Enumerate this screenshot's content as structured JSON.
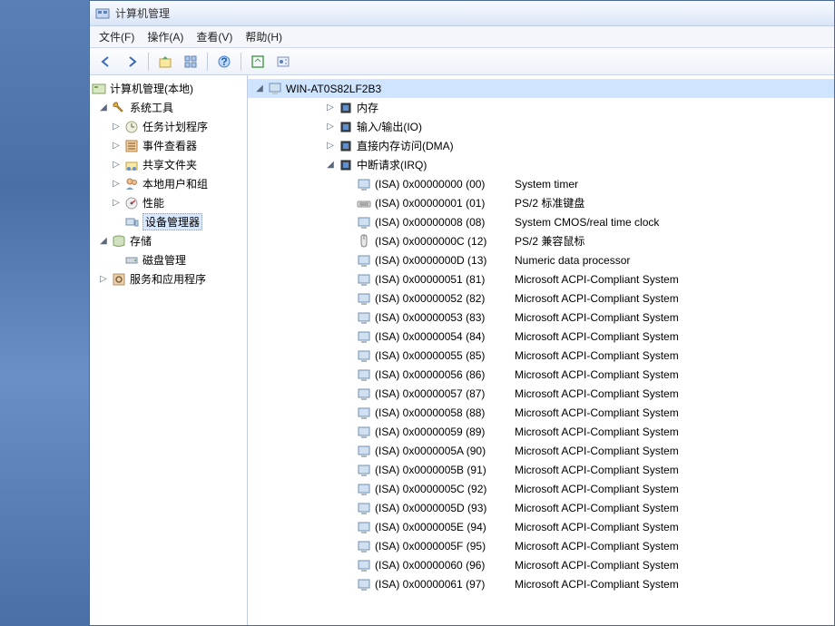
{
  "title": "计算机管理",
  "menu": {
    "file": "文件(F)",
    "action": "操作(A)",
    "view": "查看(V)",
    "help": "帮助(H)"
  },
  "left": {
    "root": "计算机管理(本地)",
    "system_tools": "系统工具",
    "task_scheduler": "任务计划程序",
    "event_viewer": "事件查看器",
    "shared_folders": "共享文件夹",
    "local_users": "本地用户和组",
    "performance": "性能",
    "device_manager": "设备管理器",
    "storage": "存储",
    "disk_mgmt": "磁盘管理",
    "services_apps": "服务和应用程序"
  },
  "right": {
    "computer": "WIN-AT0S82LF2B3",
    "memory": "内存",
    "io": "输入/输出(IO)",
    "dma": "直接内存访问(DMA)",
    "irq": "中断请求(IRQ)",
    "items": [
      {
        "addr": "(ISA) 0x00000000 (00)",
        "desc": "System timer"
      },
      {
        "addr": "(ISA) 0x00000001 (01)",
        "desc": "PS/2 标准键盘"
      },
      {
        "addr": "(ISA) 0x00000008 (08)",
        "desc": "System CMOS/real time clock"
      },
      {
        "addr": "(ISA) 0x0000000C (12)",
        "desc": "PS/2 兼容鼠标"
      },
      {
        "addr": "(ISA) 0x0000000D (13)",
        "desc": "Numeric data processor"
      },
      {
        "addr": "(ISA) 0x00000051 (81)",
        "desc": "Microsoft ACPI-Compliant System"
      },
      {
        "addr": "(ISA) 0x00000052 (82)",
        "desc": "Microsoft ACPI-Compliant System"
      },
      {
        "addr": "(ISA) 0x00000053 (83)",
        "desc": "Microsoft ACPI-Compliant System"
      },
      {
        "addr": "(ISA) 0x00000054 (84)",
        "desc": "Microsoft ACPI-Compliant System"
      },
      {
        "addr": "(ISA) 0x00000055 (85)",
        "desc": "Microsoft ACPI-Compliant System"
      },
      {
        "addr": "(ISA) 0x00000056 (86)",
        "desc": "Microsoft ACPI-Compliant System"
      },
      {
        "addr": "(ISA) 0x00000057 (87)",
        "desc": "Microsoft ACPI-Compliant System"
      },
      {
        "addr": "(ISA) 0x00000058 (88)",
        "desc": "Microsoft ACPI-Compliant System"
      },
      {
        "addr": "(ISA) 0x00000059 (89)",
        "desc": "Microsoft ACPI-Compliant System"
      },
      {
        "addr": "(ISA) 0x0000005A (90)",
        "desc": "Microsoft ACPI-Compliant System"
      },
      {
        "addr": "(ISA) 0x0000005B (91)",
        "desc": "Microsoft ACPI-Compliant System"
      },
      {
        "addr": "(ISA) 0x0000005C (92)",
        "desc": "Microsoft ACPI-Compliant System"
      },
      {
        "addr": "(ISA) 0x0000005D (93)",
        "desc": "Microsoft ACPI-Compliant System"
      },
      {
        "addr": "(ISA) 0x0000005E (94)",
        "desc": "Microsoft ACPI-Compliant System"
      },
      {
        "addr": "(ISA) 0x0000005F (95)",
        "desc": "Microsoft ACPI-Compliant System"
      },
      {
        "addr": "(ISA) 0x00000060 (96)",
        "desc": "Microsoft ACPI-Compliant System"
      },
      {
        "addr": "(ISA) 0x00000061 (97)",
        "desc": "Microsoft ACPI-Compliant System"
      }
    ]
  }
}
